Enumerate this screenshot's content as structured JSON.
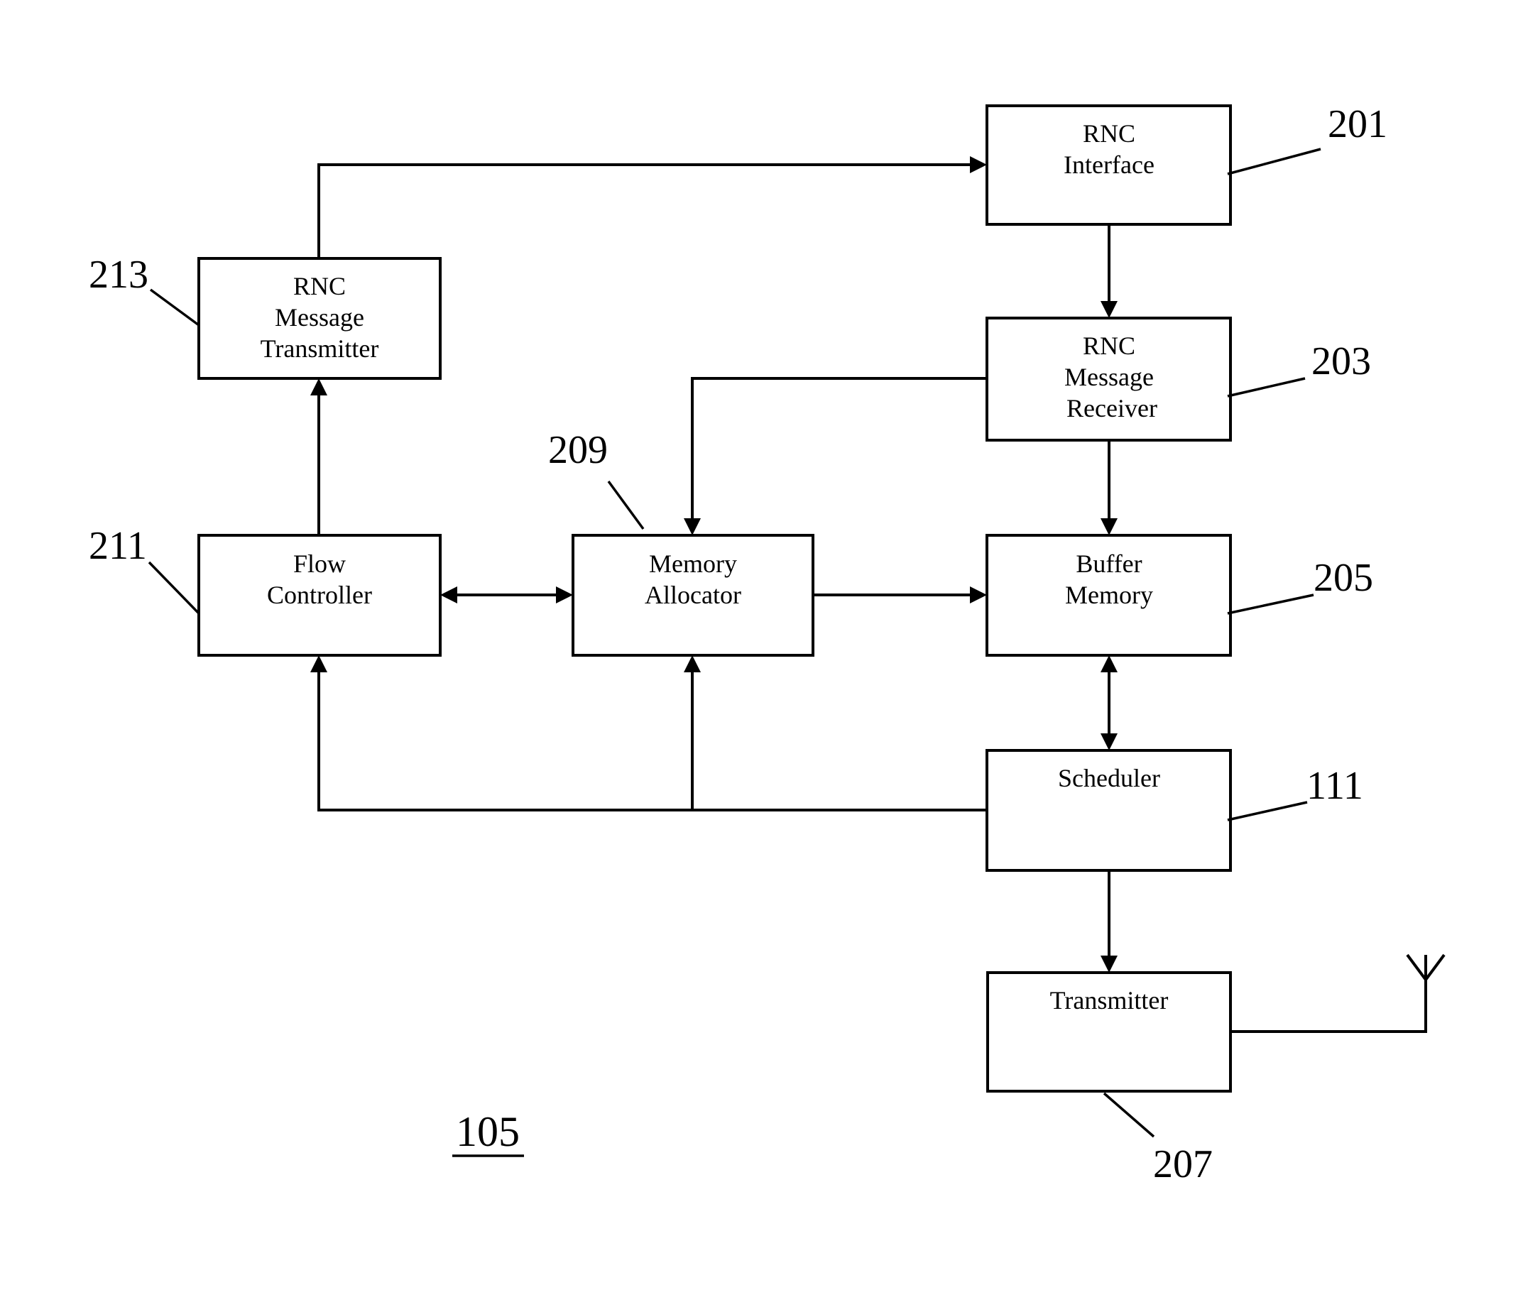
{
  "figure": {
    "label": "105",
    "blocks": [
      {
        "id": "rnc-interface",
        "ref": "201",
        "lines": [
          "RNC",
          "Interface"
        ]
      },
      {
        "id": "rnc-message-receiver",
        "ref": "203",
        "lines": [
          "RNC",
          "Message",
          "Receiver"
        ]
      },
      {
        "id": "buffer-memory",
        "ref": "205",
        "lines": [
          "Buffer",
          "Memory"
        ]
      },
      {
        "id": "scheduler",
        "ref": "111",
        "lines": [
          "Scheduler"
        ]
      },
      {
        "id": "transmitter",
        "ref": "207",
        "lines": [
          "Transmitter"
        ]
      },
      {
        "id": "memory-allocator",
        "ref": "209",
        "lines": [
          "Memory",
          "Allocator"
        ]
      },
      {
        "id": "flow-controller",
        "ref": "211",
        "lines": [
          "Flow",
          "Controller"
        ]
      },
      {
        "id": "rnc-message-transmitter",
        "ref": "213",
        "lines": [
          "RNC",
          "Message",
          "Transmitter"
        ]
      }
    ],
    "connections": [
      {
        "from": "rnc-message-transmitter",
        "to": "rnc-interface",
        "direction": "one-way"
      },
      {
        "from": "rnc-interface",
        "to": "rnc-message-receiver",
        "direction": "one-way"
      },
      {
        "from": "rnc-message-receiver",
        "to": "memory-allocator",
        "direction": "one-way"
      },
      {
        "from": "rnc-message-receiver",
        "to": "buffer-memory",
        "direction": "one-way"
      },
      {
        "from": "flow-controller",
        "to": "memory-allocator",
        "direction": "two-way"
      },
      {
        "from": "memory-allocator",
        "to": "buffer-memory",
        "direction": "one-way"
      },
      {
        "from": "flow-controller",
        "to": "rnc-message-transmitter",
        "direction": "one-way"
      },
      {
        "from": "buffer-memory",
        "to": "scheduler",
        "direction": "two-way"
      },
      {
        "from": "scheduler",
        "to": "flow-controller",
        "direction": "one-way"
      },
      {
        "from": "scheduler",
        "to": "memory-allocator",
        "direction": "one-way"
      },
      {
        "from": "scheduler",
        "to": "transmitter",
        "direction": "one-way"
      },
      {
        "from": "transmitter",
        "to": "antenna",
        "direction": "line"
      }
    ]
  }
}
